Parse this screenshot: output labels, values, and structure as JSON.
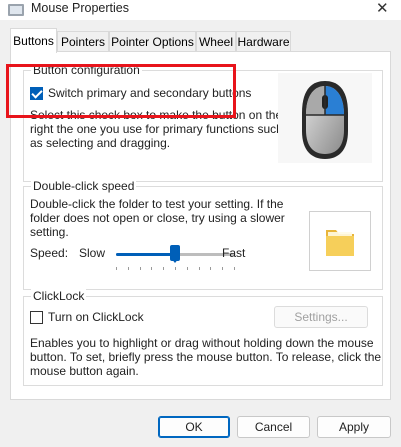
{
  "window": {
    "title": "Mouse Properties"
  },
  "tabs": [
    {
      "label": "Buttons",
      "active": true
    },
    {
      "label": "Pointers",
      "active": false
    },
    {
      "label": "Pointer Options",
      "active": false
    },
    {
      "label": "Wheel",
      "active": false
    },
    {
      "label": "Hardware",
      "active": false
    }
  ],
  "button_config": {
    "legend": "Button configuration",
    "switch_label": "Switch primary and secondary buttons",
    "switch_checked": true,
    "description_lines": [
      "Select this check box to make the button on the",
      "right the one you use for primary functions such",
      "as selecting and dragging."
    ]
  },
  "double_click": {
    "legend": "Double-click speed",
    "description_lines": [
      "Double-click the folder to test your setting. If the",
      "folder does not open or close, try using a slower",
      "setting."
    ],
    "speed_label": "Speed:",
    "slow_label": "Slow",
    "fast_label": "Fast",
    "speed_fraction": 0.5
  },
  "clicklock": {
    "legend": "ClickLock",
    "turn_on_label": "Turn on ClickLock",
    "checked": false,
    "settings_label": "Settings...",
    "description_lines": [
      "Enables you to highlight or drag without holding down the mouse",
      "button. To set, briefly press the mouse button. To release, click the",
      "mouse button again."
    ]
  },
  "footer": {
    "ok_label": "OK",
    "cancel_label": "Cancel",
    "apply_label": "Apply"
  },
  "colors": {
    "accent": "#005fb8",
    "annotation": "#e8141b"
  }
}
